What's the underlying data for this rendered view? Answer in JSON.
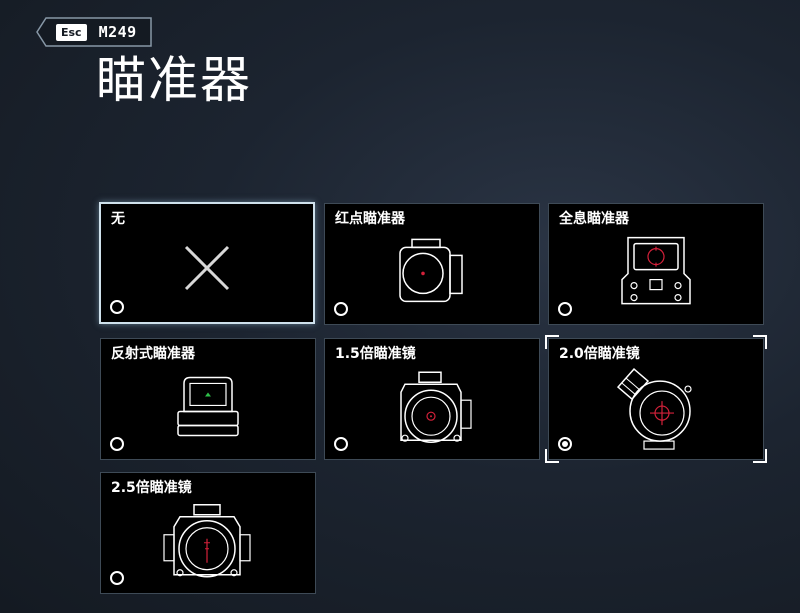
{
  "header": {
    "esc_label": "Esc",
    "weapon": "M249",
    "title": "瞄准器"
  },
  "accent_color": "#d4213a",
  "options": [
    {
      "label": "无",
      "icon": "none-x-icon",
      "selected": false,
      "hovered": true
    },
    {
      "label": "红点瞄准器",
      "icon": "red-dot-sight-icon",
      "selected": false,
      "hovered": false
    },
    {
      "label": "全息瞄准器",
      "icon": "holographic-sight-icon",
      "selected": false,
      "hovered": false
    },
    {
      "label": "反射式瞄准器",
      "icon": "reflex-sight-icon",
      "selected": false,
      "hovered": false
    },
    {
      "label": "1.5倍瞄准镜",
      "icon": "scope-1-5x-icon",
      "selected": false,
      "hovered": false
    },
    {
      "label": "2.0倍瞄准镜",
      "icon": "scope-2-0x-icon",
      "selected": true,
      "hovered": false
    },
    {
      "label": "2.5倍瞄准镜",
      "icon": "scope-2-5x-icon",
      "selected": false,
      "hovered": false
    }
  ]
}
